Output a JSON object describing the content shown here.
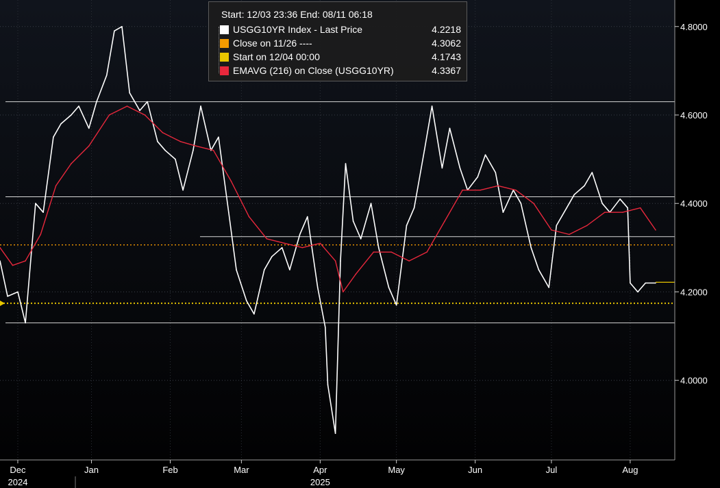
{
  "legend": {
    "title": "Start: 12/03 23:36 End: 08/11 06:18",
    "entries": [
      {
        "label": "USGG10YR Index - Last Price",
        "value": "4.2218",
        "color": "#ffffff"
      },
      {
        "label": "Close on 11/26 ----",
        "value": "4.3062",
        "color": "#f59b00"
      },
      {
        "label": "Start on 12/04 00:00",
        "value": "4.1743",
        "color": "#e8c600"
      },
      {
        "label": "EMAVG (216)  on Close (USGG10YR)",
        "value": "4.3367",
        "color": "#e8283c"
      }
    ]
  },
  "chart_data": {
    "type": "line",
    "title": "",
    "xlabel": "",
    "ylabel": "",
    "ylim": [
      3.82,
      4.86
    ],
    "yticks": [
      "4.8000",
      "4.6000",
      "4.4000",
      "4.2000",
      "4.0000"
    ],
    "ytick_values": [
      4.8,
      4.6,
      4.4,
      4.2,
      4.0
    ],
    "xtick_months": [
      "Dec",
      "Jan",
      "Feb",
      "Mar",
      "Apr",
      "May",
      "Jun",
      "Jul",
      "Aug"
    ],
    "xtick_dates": [
      "2024-12-03",
      "2025-01-01",
      "2025-02-01",
      "2025-03-01",
      "2025-04-01",
      "2025-05-01",
      "2025-06-01",
      "2025-07-01",
      "2025-08-01"
    ],
    "year_labels": [
      {
        "text": "2024",
        "date": "2024-12-03"
      },
      {
        "text": "2025",
        "date": "2025-04-01"
      }
    ],
    "xlim": [
      "2024-11-26",
      "2025-08-11"
    ],
    "reference_lines": [
      {
        "name": "Close on 11/26 ----",
        "value": 4.3062,
        "color": "#f59b00",
        "style": "dotted"
      },
      {
        "name": "Start on 12/04 00:00",
        "value": 4.1743,
        "color": "#e8c600",
        "style": "dotted"
      }
    ],
    "horizontal_levels": [
      4.63,
      4.415,
      4.325,
      4.13
    ],
    "last_price": {
      "value": 4.2218,
      "color": "#e8c600"
    },
    "grid": true,
    "legend_position": "top-center",
    "series": [
      {
        "name": "USGG10YR Index - Last Price",
        "color": "#ffffff",
        "x": [
          "2024-11-26",
          "2024-11-29",
          "2024-12-03",
          "2024-12-06",
          "2024-12-10",
          "2024-12-13",
          "2024-12-17",
          "2024-12-20",
          "2024-12-24",
          "2024-12-27",
          "2024-12-31",
          "2025-01-03",
          "2025-01-07",
          "2025-01-10",
          "2025-01-13",
          "2025-01-16",
          "2025-01-20",
          "2025-01-23",
          "2025-01-27",
          "2025-01-30",
          "2025-02-03",
          "2025-02-06",
          "2025-02-10",
          "2025-02-13",
          "2025-02-17",
          "2025-02-20",
          "2025-02-24",
          "2025-02-27",
          "2025-03-03",
          "2025-03-06",
          "2025-03-10",
          "2025-03-13",
          "2025-03-17",
          "2025-03-20",
          "2025-03-24",
          "2025-03-27",
          "2025-03-31",
          "2025-04-03",
          "2025-04-04",
          "2025-04-07",
          "2025-04-09",
          "2025-04-11",
          "2025-04-14",
          "2025-04-17",
          "2025-04-21",
          "2025-04-24",
          "2025-04-28",
          "2025-05-01",
          "2025-05-05",
          "2025-05-08",
          "2025-05-12",
          "2025-05-15",
          "2025-05-19",
          "2025-05-22",
          "2025-05-26",
          "2025-05-29",
          "2025-06-02",
          "2025-06-05",
          "2025-06-09",
          "2025-06-12",
          "2025-06-16",
          "2025-06-19",
          "2025-06-23",
          "2025-06-26",
          "2025-06-30",
          "2025-07-03",
          "2025-07-07",
          "2025-07-10",
          "2025-07-14",
          "2025-07-17",
          "2025-07-21",
          "2025-07-24",
          "2025-07-28",
          "2025-07-31",
          "2025-08-01",
          "2025-08-04",
          "2025-08-07",
          "2025-08-11"
        ],
        "y": [
          4.27,
          4.19,
          4.2,
          4.13,
          4.4,
          4.38,
          4.55,
          4.58,
          4.6,
          4.62,
          4.57,
          4.63,
          4.69,
          4.79,
          4.8,
          4.65,
          4.61,
          4.63,
          4.54,
          4.52,
          4.5,
          4.43,
          4.52,
          4.62,
          4.52,
          4.55,
          4.38,
          4.25,
          4.18,
          4.15,
          4.25,
          4.28,
          4.3,
          4.25,
          4.33,
          4.37,
          4.21,
          4.12,
          3.99,
          3.88,
          4.27,
          4.49,
          4.36,
          4.32,
          4.4,
          4.3,
          4.21,
          4.17,
          4.35,
          4.39,
          4.52,
          4.62,
          4.48,
          4.57,
          4.48,
          4.43,
          4.46,
          4.51,
          4.47,
          4.38,
          4.43,
          4.4,
          4.3,
          4.25,
          4.21,
          4.35,
          4.39,
          4.42,
          4.44,
          4.47,
          4.4,
          4.38,
          4.41,
          4.39,
          4.22,
          4.2,
          4.22,
          4.22
        ]
      },
      {
        "name": "EMAVG (216)  on Close (USGG10YR)",
        "color": "#e8283c",
        "x": [
          "2024-11-26",
          "2024-12-01",
          "2024-12-06",
          "2024-12-12",
          "2024-12-18",
          "2024-12-24",
          "2024-12-31",
          "2025-01-08",
          "2025-01-15",
          "2025-01-22",
          "2025-01-29",
          "2025-02-05",
          "2025-02-11",
          "2025-02-18",
          "2025-02-25",
          "2025-03-04",
          "2025-03-11",
          "2025-03-18",
          "2025-03-25",
          "2025-04-01",
          "2025-04-07",
          "2025-04-10",
          "2025-04-15",
          "2025-04-22",
          "2025-04-29",
          "2025-05-06",
          "2025-05-13",
          "2025-05-20",
          "2025-05-27",
          "2025-06-03",
          "2025-06-10",
          "2025-06-17",
          "2025-06-24",
          "2025-07-01",
          "2025-07-08",
          "2025-07-15",
          "2025-07-22",
          "2025-07-29",
          "2025-08-05",
          "2025-08-11"
        ],
        "y": [
          4.3,
          4.26,
          4.27,
          4.33,
          4.44,
          4.49,
          4.53,
          4.6,
          4.62,
          4.6,
          4.56,
          4.54,
          4.53,
          4.52,
          4.45,
          4.37,
          4.32,
          4.31,
          4.3,
          4.31,
          4.27,
          4.2,
          4.24,
          4.29,
          4.29,
          4.27,
          4.29,
          4.36,
          4.43,
          4.43,
          4.44,
          4.43,
          4.4,
          4.34,
          4.33,
          4.35,
          4.38,
          4.38,
          4.39,
          4.34
        ]
      }
    ]
  }
}
